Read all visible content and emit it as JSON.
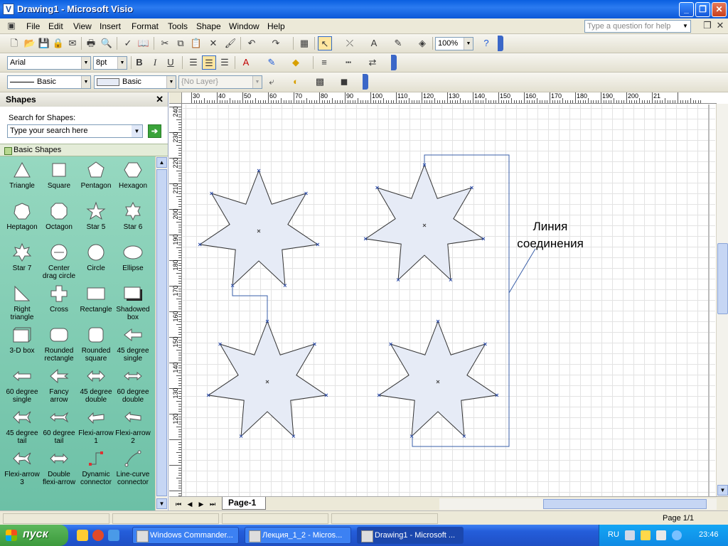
{
  "window": {
    "title": "Drawing1 - Microsoft Visio",
    "controls": {
      "minimize": "_",
      "maximize": "❐",
      "close": "✕"
    }
  },
  "menu": {
    "items": [
      "File",
      "Edit",
      "View",
      "Insert",
      "Format",
      "Tools",
      "Shape",
      "Window",
      "Help"
    ],
    "help_placeholder": "Type a question for help"
  },
  "toolbar_standard": {
    "zoom": "100%"
  },
  "toolbar_format": {
    "font": "Arial",
    "size": "8pt"
  },
  "toolbar_line": {
    "line_style": "Basic",
    "fill_style": "Basic",
    "layer": "{No Layer}"
  },
  "shapes_pane": {
    "title": "Shapes",
    "search_label": "Search for Shapes:",
    "search_placeholder": "Type your search here",
    "stencil_title": "Basic Shapes",
    "masters": [
      "Triangle",
      "Square",
      "Pentagon",
      "Hexagon",
      "Heptagon",
      "Octagon",
      "Star 5",
      "Star 6",
      "Star 7",
      "Center drag circle",
      "Circle",
      "Ellipse",
      "Right triangle",
      "Cross",
      "Rectangle",
      "Shadowed box",
      "3-D box",
      "Rounded rectangle",
      "Rounded square",
      "45 degree single",
      "60 degree single",
      "Fancy arrow",
      "45 degree double",
      "60 degree double",
      "45 degree tail",
      "60 degree tail",
      "Flexi-arrow 1",
      "Flexi-arrow 2",
      "Flexi-arrow 3",
      "Double flexi-arrow",
      "Dynamic connector",
      "Line-curve connector"
    ]
  },
  "rulers": {
    "horizontal": [
      "30",
      "40",
      "50",
      "60",
      "70",
      "80",
      "90",
      "100",
      "110",
      "120",
      "130",
      "140",
      "150",
      "160",
      "170",
      "180",
      "190",
      "200",
      "21"
    ],
    "vertical": [
      "240",
      "230",
      "220",
      "210",
      "200",
      "190",
      "180",
      "170",
      "160",
      "150",
      "140",
      "130",
      "120"
    ]
  },
  "drawing": {
    "callout_line1": "Линия",
    "callout_line2": "соединения",
    "shape_color": "#e6ebf6",
    "line_color": "#3a5fa8"
  },
  "page_tab": "Page-1",
  "status": {
    "page": "Page 1/1"
  },
  "taskbar": {
    "start": "пуск",
    "tasks": [
      "Windows Commander...",
      "Лекция_1_2 - Micros...",
      "Drawing1 - Microsoft ..."
    ],
    "language": "RU",
    "clock": "23:46"
  }
}
